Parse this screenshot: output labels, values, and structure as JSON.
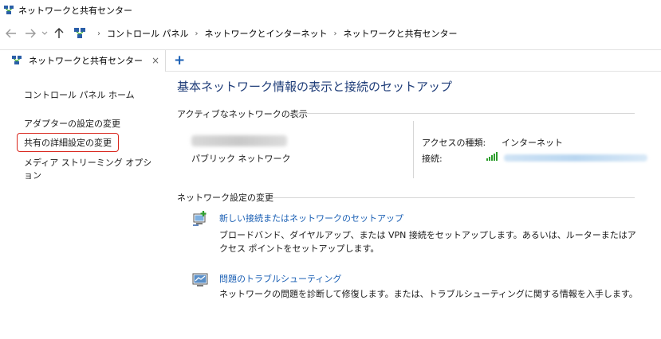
{
  "window": {
    "title": "ネットワークと共有センター"
  },
  "address": {
    "breadcrumbs": [
      "コントロール パネル",
      "ネットワークとインターネット",
      "ネットワークと共有センター"
    ],
    "back_icon": "back-arrow-icon",
    "forward_icon": "forward-arrow-icon",
    "up_icon": "up-arrow-icon"
  },
  "tabs": [
    {
      "label": "ネットワークと共有センター",
      "close": "×"
    }
  ],
  "add_tab": "+",
  "sidebar": {
    "items": [
      {
        "label": "コントロール パネル ホーム"
      },
      {
        "label": "アダプターの設定の変更"
      },
      {
        "label": "共有の詳細設定の変更"
      },
      {
        "label": "メディア ストリーミング オプション"
      }
    ]
  },
  "main": {
    "title": "基本ネットワーク情報の表示と接続のセットアップ",
    "active_section": "アクティブなネットワークの表示",
    "network_type": "パブリック ネットワーク",
    "access_label": "アクセスの種類:",
    "access_value": "インターネット",
    "connection_label": "接続:",
    "change_section": "ネットワーク設定の変更",
    "tasks": [
      {
        "link": "新しい接続またはネットワークのセットアップ",
        "desc": "ブロードバンド、ダイヤルアップ、または VPN 接続をセットアップします。あるいは、ルーターまたはアクセス ポイントをセットアップします。"
      },
      {
        "link": "問題のトラブルシューティング",
        "desc": "ネットワークの問題を診断して修復します。または、トラブルシューティングに関する情報を入手します。"
      }
    ]
  },
  "colors": {
    "title_blue": "#1e3c78",
    "link_blue": "#1a5fb4",
    "highlight_red": "#d9261c",
    "signal_green": "#2e9e2e"
  }
}
